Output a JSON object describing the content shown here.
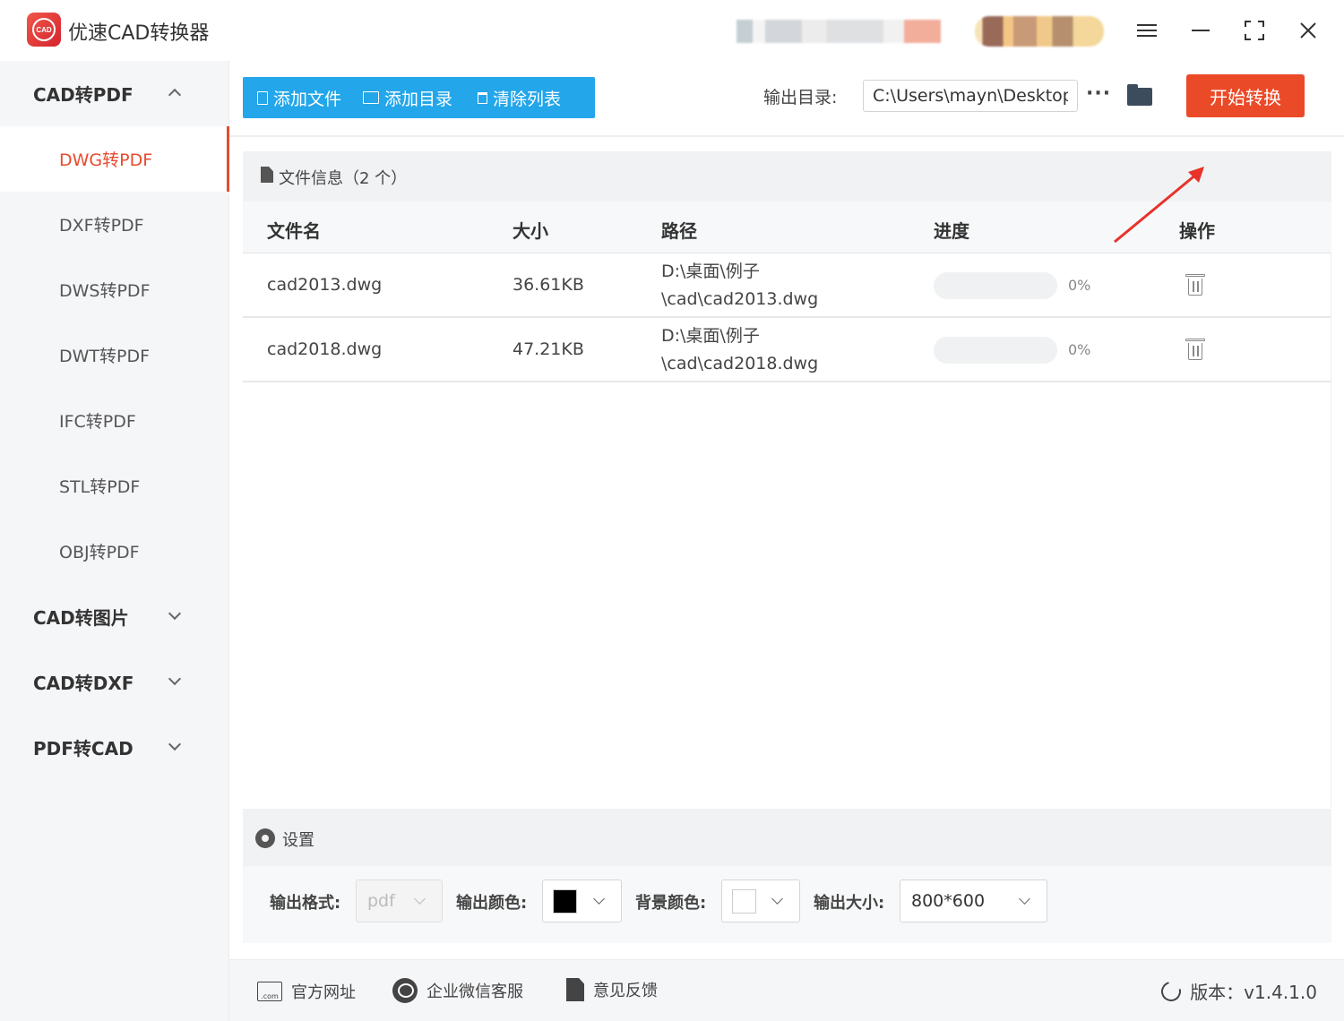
{
  "app": {
    "title": "优速CAD转换器",
    "logo_text": "CAD"
  },
  "window_controls": [
    "menu-icon",
    "minimize-icon",
    "maximize-icon",
    "close-icon"
  ],
  "sidebar": {
    "groups": [
      {
        "label": "CAD转PDF",
        "expanded": true,
        "items": [
          {
            "label": "DWG转PDF",
            "active": true
          },
          {
            "label": "DXF转PDF"
          },
          {
            "label": "DWS转PDF"
          },
          {
            "label": "DWT转PDF"
          },
          {
            "label": "IFC转PDF"
          },
          {
            "label": "STL转PDF"
          },
          {
            "label": "OBJ转PDF"
          }
        ]
      },
      {
        "label": "CAD转图片",
        "expanded": false
      },
      {
        "label": "CAD转DXF",
        "expanded": false
      },
      {
        "label": "PDF转CAD",
        "expanded": false
      }
    ]
  },
  "toolbar": {
    "add_file": "添加文件",
    "add_dir": "添加目录",
    "clear_list": "清除列表",
    "output_label": "输出目录:",
    "output_path": "C:\\Users\\mayn\\Desktop",
    "more": "···",
    "start": "开始转换"
  },
  "file_panel": {
    "title": "文件信息（2 个）",
    "columns": {
      "name": "文件名",
      "size": "大小",
      "path": "路径",
      "progress": "进度",
      "action": "操作"
    },
    "rows": [
      {
        "name": "cad2013.dwg",
        "size": "36.61KB",
        "path": "D:\\桌面\\例子\\cad\\cad2013.dwg",
        "progress": 0,
        "progress_label": "0%"
      },
      {
        "name": "cad2018.dwg",
        "size": "47.21KB",
        "path": "D:\\桌面\\例子\\cad\\cad2018.dwg",
        "progress": 0,
        "progress_label": "0%"
      }
    ]
  },
  "settings": {
    "title": "设置",
    "format_label": "输出格式:",
    "format_value": "pdf",
    "color_label": "输出颜色:",
    "color_value": "#000000",
    "bg_label": "背景颜色:",
    "bg_value": "#ffffff",
    "size_label": "输出大小:",
    "size_value": "800*600"
  },
  "footer": {
    "website": "官方网址",
    "wechat": "企业微信客服",
    "feedback": "意见反馈",
    "version": "版本：v1.4.1.0"
  },
  "colors": {
    "accent_blue": "#23a6ea",
    "accent_red": "#eb4a28",
    "active_item": "#e84a2f"
  }
}
